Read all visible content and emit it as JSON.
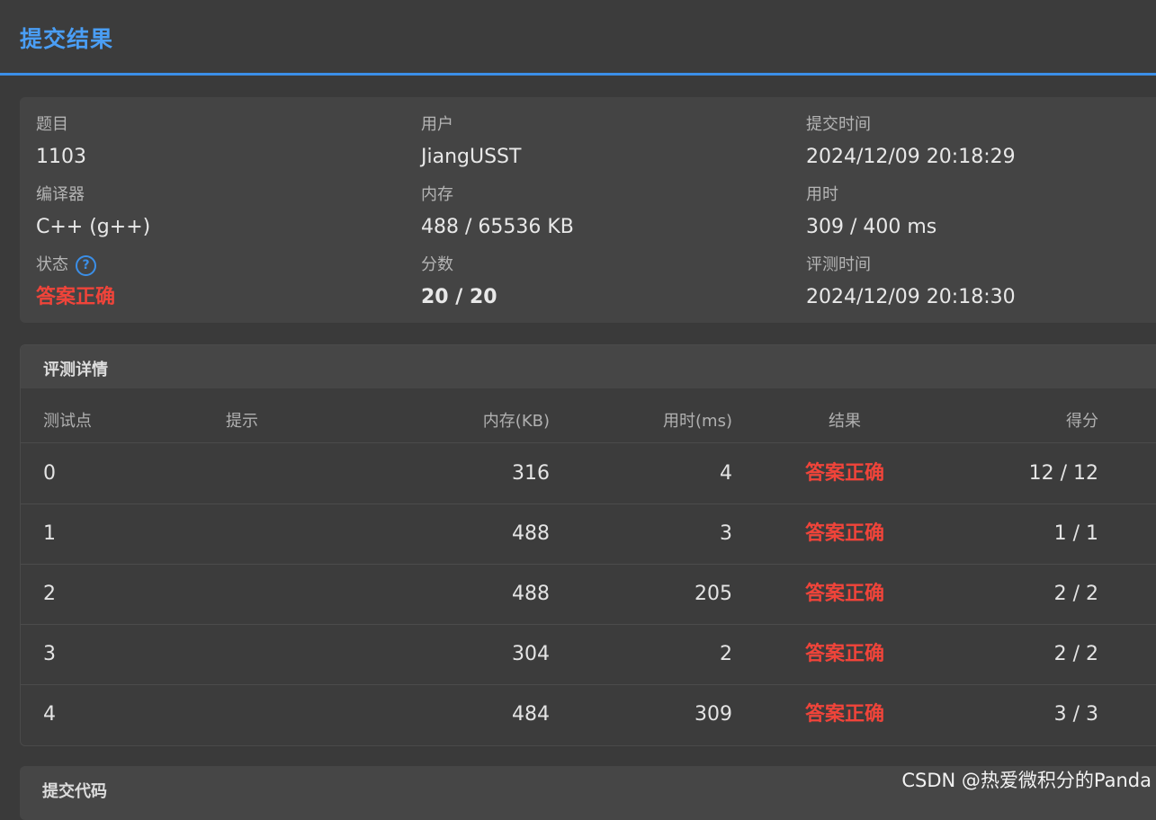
{
  "header": {
    "title": "提交结果"
  },
  "info": {
    "problem_label": "题目",
    "problem_value": "1103",
    "user_label": "用户",
    "user_value": "JiangUSST",
    "submit_time_label": "提交时间",
    "submit_time_value": "2024/12/09 20:18:29",
    "compiler_label": "编译器",
    "compiler_value": "C++ (g++)",
    "memory_label": "内存",
    "memory_value": "488 / 65536 KB",
    "time_label": "用时",
    "time_value": "309 / 400 ms",
    "status_label": "状态",
    "status_help_icon": "?",
    "status_value": "答案正确",
    "score_label": "分数",
    "score_value": "20 / 20",
    "judge_time_label": "评测时间",
    "judge_time_value": "2024/12/09 20:18:30"
  },
  "details": {
    "title": "评测详情",
    "columns": {
      "case": "测试点",
      "hint": "提示",
      "memory": "内存(KB)",
      "time": "用时(ms)",
      "result": "结果",
      "score": "得分"
    },
    "rows": [
      {
        "case": "0",
        "hint": "",
        "memory": "316",
        "time": "4",
        "result": "答案正确",
        "score": "12 / 12"
      },
      {
        "case": "1",
        "hint": "",
        "memory": "488",
        "time": "3",
        "result": "答案正确",
        "score": "1 / 1"
      },
      {
        "case": "2",
        "hint": "",
        "memory": "488",
        "time": "205",
        "result": "答案正确",
        "score": "2 / 2"
      },
      {
        "case": "3",
        "hint": "",
        "memory": "304",
        "time": "2",
        "result": "答案正确",
        "score": "2 / 2"
      },
      {
        "case": "4",
        "hint": "",
        "memory": "484",
        "time": "309",
        "result": "答案正确",
        "score": "3 / 3"
      }
    ]
  },
  "code": {
    "title": "提交代码"
  },
  "watermark": "CSDN @热爱微积分的Panda",
  "colors": {
    "accent": "#3b8fe8",
    "accepted": "#f0443a",
    "background": "#3a3a3a"
  }
}
